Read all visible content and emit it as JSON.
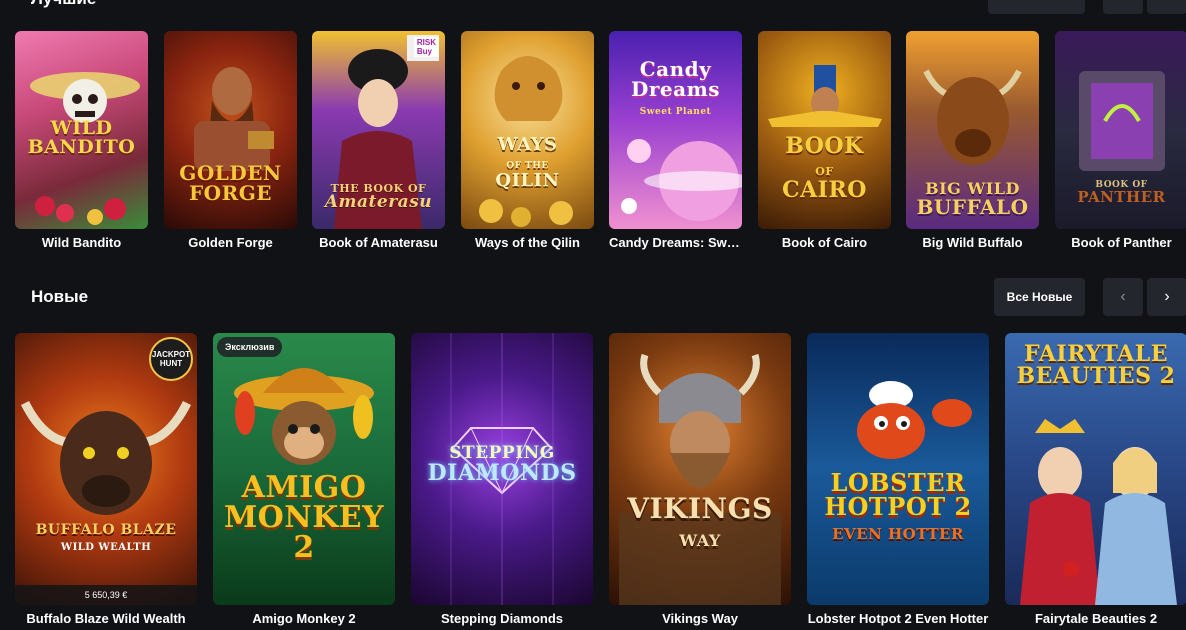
{
  "section_top": {
    "title": "Лучшие",
    "games": [
      {
        "name": "Wild Bandito",
        "logo": "WILD BANDITO",
        "colors": [
          "#c94a7a",
          "#3a8c3a"
        ]
      },
      {
        "name": "Golden Forge",
        "logo": "GOLDEN FORGE",
        "colors": [
          "#8a2410",
          "#f0b030"
        ]
      },
      {
        "name": "Book of Amaterasu",
        "logo": "THE BOOK OF Amaterasu",
        "badge": "RISK Buy",
        "colors": [
          "#3a2a6a",
          "#e0a030"
        ]
      },
      {
        "name": "Ways of the Qilin",
        "logo": "WAYS OF THE QILIN",
        "colors": [
          "#c98a20",
          "#f7d57a"
        ]
      },
      {
        "name": "Candy Dreams: Sweet Planet",
        "logo": "Candy Dreams Sweet Planet",
        "colors": [
          "#7a3ad0",
          "#f070c0"
        ]
      },
      {
        "name": "Book of Cairo",
        "logo": "BOOK OF CAIRO",
        "colors": [
          "#6a3a10",
          "#f0b020"
        ]
      },
      {
        "name": "Big Wild Buffalo",
        "logo": "BIG WILD BUFFALO",
        "colors": [
          "#5a2a80",
          "#d08030"
        ]
      },
      {
        "name": "Book of Panther",
        "logo": "BOOK OF PANTHER",
        "colors": [
          "#2a2a40",
          "#8040a0"
        ]
      }
    ]
  },
  "section_new": {
    "title": "Новые",
    "all_button": "Все Новые",
    "prev_icon": "‹",
    "next_icon": "›",
    "games": [
      {
        "name": "Buffalo Blaze Wild Wealth",
        "logo": "BUFFALO BLAZE",
        "sub": "WILD WEALTH",
        "jackpot_label": "JACKPOT HUNT",
        "jackpot_amount": "5 650,39 €",
        "colors": [
          "#3a1208",
          "#e85a10"
        ]
      },
      {
        "name": "Amigo Monkey 2",
        "logo": "AMIGO MONKEY 2",
        "badge": "Эксклюзив",
        "colors": [
          "#1a6a3a",
          "#f0b020"
        ]
      },
      {
        "name": "Stepping Diamonds",
        "logo": "STEPPING DIAMONDS",
        "colors": [
          "#2a0a4a",
          "#8a30d0"
        ]
      },
      {
        "name": "Vikings Way",
        "logo": "VIKINGS WAY",
        "colors": [
          "#3a1a0a",
          "#c06020"
        ]
      },
      {
        "name": "Lobster Hotpot 2 Even Hotter",
        "logo": "LOBSTER HOTPOT 2",
        "sub": "EVEN HOTTER",
        "colors": [
          "#0a3a6a",
          "#2a8ad0"
        ]
      },
      {
        "name": "Fairytale Beauties 2",
        "logo": "FAIRYTALE BEAUTIES 2",
        "colors": [
          "#1a3a7a",
          "#c02030"
        ]
      }
    ]
  }
}
